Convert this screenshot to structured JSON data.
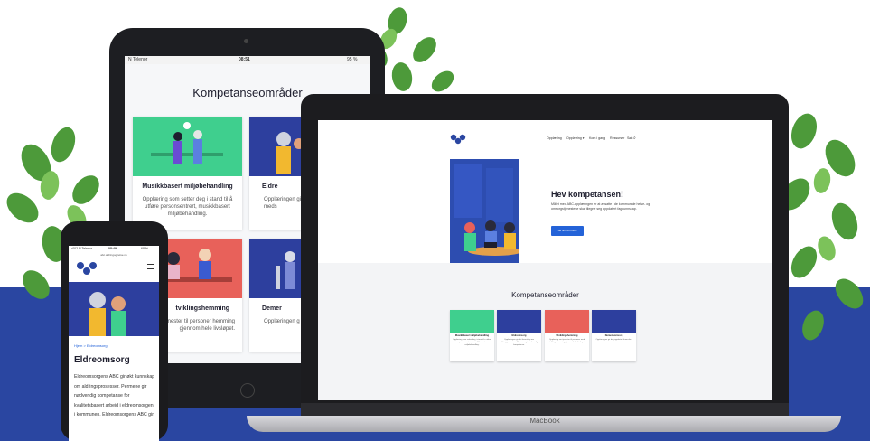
{
  "colors": {
    "brand_blue": "#2a46a1",
    "button_blue": "#2463d8",
    "card_green": "#3fcf8e",
    "card_navy": "#2d3f9e",
    "card_coral": "#e8615a",
    "leaf_green": "#4d9a3a"
  },
  "tablet": {
    "status": {
      "carrier": "N Telenor",
      "time": "08:51",
      "battery": "95 %"
    },
    "section_title": "Kompetanseområder",
    "cards": [
      {
        "title": "Musikkbasert miljøbehandling",
        "desc": "Opplæring som setter deg i stand til å utføre personsentrert, musikkbasert miljøbehandling."
      },
      {
        "title": "Eldre",
        "desc": "Opplæringen gi aldringsprosess meds"
      },
      {
        "title": "tviklingshemming",
        "desc": "g om tjenester til personer hemming gjennom hele livsløpet."
      },
      {
        "title": "Demer",
        "desc": "Opplæringen g oppdatert kunn"
      }
    ]
  },
  "laptop": {
    "brand": "MacBook",
    "logo": "abc",
    "nav": [
      "Opplæring",
      "Opplæring ▾",
      "Kom i gang",
      "Ressurser",
      "Søk"
    ],
    "hero": {
      "title": "Hev kompetansen!",
      "desc": "Målet med ABC-opplæringen er at ansatte i de kommunale helse- og omsorgstjenestene skal tilegne seg oppdatert fagkunnskap.",
      "button": "Se film om ABC"
    },
    "section_title": "Kompetanseområder",
    "cards": [
      {
        "title": "Musikkbasert miljøbehandling",
        "desc": "Opplæring som setter deg i stand til å utføre personsentrert, musikkbasert miljøbehandling."
      },
      {
        "title": "Eldreomsorg",
        "desc": "Opplæringen gir økt kunnskap om aldringsprosesser. Permene gir nødvendig kompetanse."
      },
      {
        "title": "Utviklingshemming",
        "desc": "Opplæring om tjenester til personer med utviklingshemming gjennom hele livsløpet."
      },
      {
        "title": "Demensomsorg",
        "desc": "Opplæringen gir deg oppdatert kunnskap om demens."
      }
    ]
  },
  "phone": {
    "status": {
      "carrier": "•002 N Telenor",
      "time": "08:49",
      "battery": "68 %"
    },
    "url": "abc.aldringoghelse.no",
    "logo": "abc",
    "breadcrumb": "Hjem > Eldreomsorg",
    "heading": "Eldreomsorg",
    "body": "Eldreomsorgens ABC gir økt kunnskap om aldringsprosesser. Permene gir nødvendig kompetanse for kvalitetsbasert arbeid i eldreomsorgen i kommunen. Eldreomsorgens ABC gir"
  }
}
